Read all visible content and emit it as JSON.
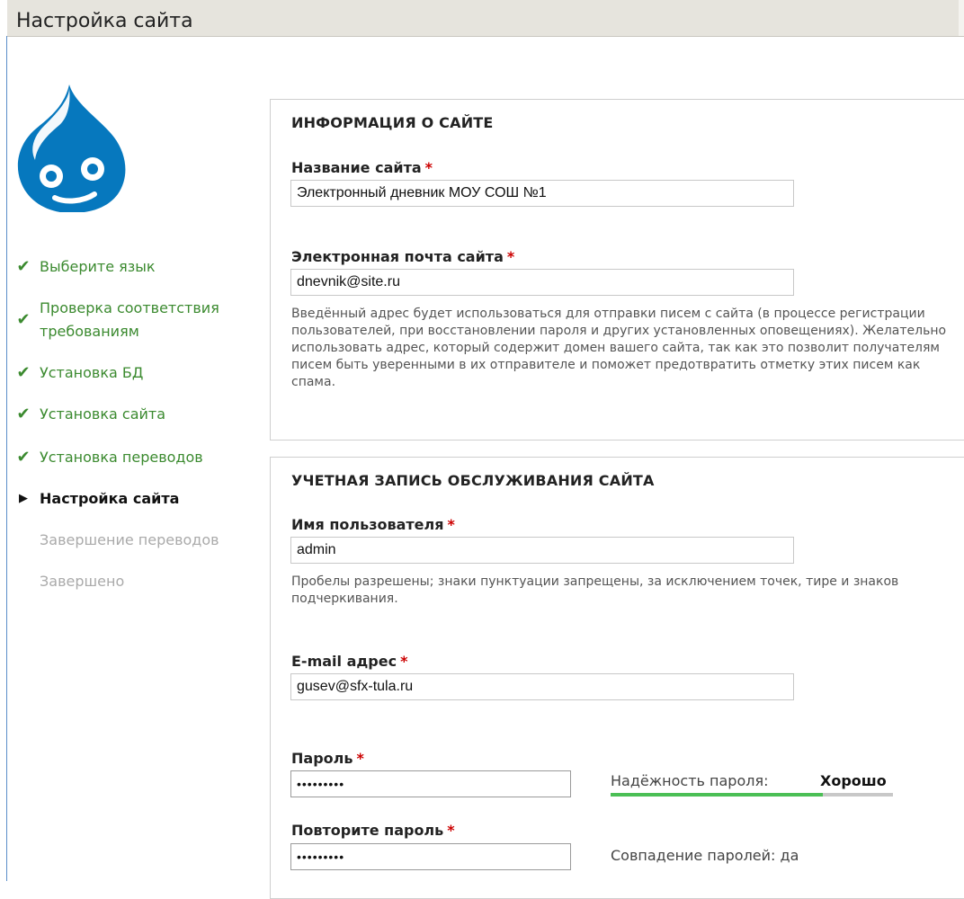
{
  "window": {
    "title": "Настройка сайта"
  },
  "steps": [
    {
      "label": "Выберите язык",
      "state": "done"
    },
    {
      "label": "Проверка соответствия требованиям",
      "state": "done"
    },
    {
      "label": "Установка БД",
      "state": "done"
    },
    {
      "label": "Установка сайта",
      "state": "done"
    },
    {
      "label": "Установка переводов",
      "state": "done"
    },
    {
      "label": "Настройка сайта",
      "state": "active"
    },
    {
      "label": "Завершение переводов",
      "state": "pending"
    },
    {
      "label": "Завершено",
      "state": "pending"
    }
  ],
  "icons": {
    "done": "✔",
    "active": "▶"
  },
  "site_info": {
    "heading": "ИНФОРМАЦИЯ О САЙТЕ",
    "site_name_label": "Название сайта",
    "site_name_value": "Электронный дневник МОУ СОШ №1",
    "site_email_label": "Электронная почта сайта",
    "site_email_value": "dnevnik@site.ru",
    "site_email_description": "Введённый адрес будет использоваться для отправки писем с сайта (в процессе регистрации пользователей, при восстановлении пароля и других установленных оповещениях). Желательно использовать адрес, который содержит домен вашего сайта, так как это позволит получателям писем быть уверенными в их отправителе и поможет предотвратить отметку этих писем как спама."
  },
  "account": {
    "heading": "УЧЕТНАЯ ЗАПИСЬ ОБСЛУЖИВАНИЯ САЙТА",
    "username_label": "Имя пользователя",
    "username_value": "admin",
    "username_description": "Пробелы разрешены; знаки пунктуации запрещены, за исключением точек, тире и знаков подчеркивания.",
    "email_label": "E-mail адрес",
    "email_value": "gusev@sfx-tula.ru",
    "password_label": "Пароль",
    "password_value": "•••••••••",
    "password_strength_label": "Надёжность пароля:",
    "password_strength_value": "Хорошо",
    "password_strength_level": 0.75,
    "confirm_label": "Повторите пароль",
    "confirm_value": "•••••••••",
    "password_match_text": "Совпадение паролей: да"
  },
  "required_marker": "*",
  "colors": {
    "done_step": "#3b8a2f",
    "required": "#cc0000",
    "strength_fill": "#4bbf55",
    "logo": "#0678be"
  }
}
